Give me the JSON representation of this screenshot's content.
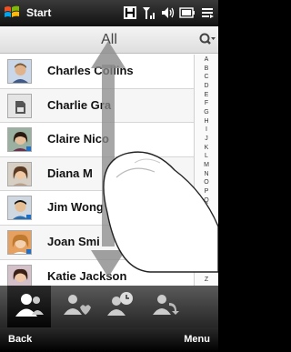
{
  "status_bar": {
    "title": "Start",
    "icons": [
      "htc-icon",
      "signal-icon",
      "volume-icon",
      "battery-icon",
      "menu-lines-icon"
    ]
  },
  "filter": {
    "title": "All"
  },
  "contacts": [
    {
      "name": "Charles Collins",
      "avatar": "photo"
    },
    {
      "name": "Charlie Gra",
      "avatar": "sim-card"
    },
    {
      "name": "Claire Nico",
      "avatar": "photo"
    },
    {
      "name": "Diana M",
      "avatar": "photo"
    },
    {
      "name": "Jim Wong",
      "avatar": "photo"
    },
    {
      "name": "Joan Smi",
      "avatar": "photo"
    },
    {
      "name": "Katie Jackson",
      "avatar": "photo"
    }
  ],
  "alpha_index": [
    "A",
    "B",
    "C",
    "D",
    "E",
    "F",
    "G",
    "H",
    "I",
    "J",
    "K",
    "L",
    "M",
    "N",
    "O",
    "P",
    "Q",
    "R",
    "S",
    "T",
    "U",
    "V",
    "W",
    "X",
    "Y",
    "Z"
  ],
  "tabs": [
    {
      "name": "people",
      "icon": "people-icon",
      "active": true
    },
    {
      "name": "favorites",
      "icon": "favorite-people-icon",
      "active": false
    },
    {
      "name": "call-history",
      "icon": "call-history-icon",
      "active": false
    },
    {
      "name": "updates",
      "icon": "contact-updates-icon",
      "active": false
    }
  ],
  "soft_keys": {
    "left": "Back",
    "right": "Menu"
  },
  "colors": {
    "accent": "#1e6fc8",
    "header_text": "#444444"
  }
}
